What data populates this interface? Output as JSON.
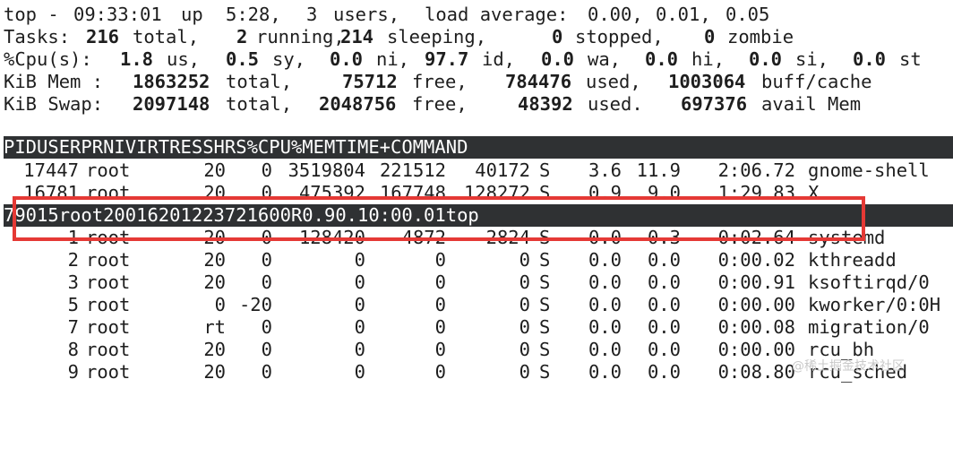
{
  "summary": {
    "uptime": {
      "title": "top - ",
      "time": "09:33:01",
      "up_label": "up",
      "up": "5:28,",
      "users": "3",
      "users_label": "users,",
      "load_label": "load average:",
      "load1": "0.00,",
      "load5": "0.01,",
      "load15": "0.05"
    },
    "tasks": {
      "label": "Tasks:",
      "total": "216",
      "total_label": "total,",
      "running": "2",
      "running_label": "running,",
      "sleeping": "214",
      "sleeping_label": "sleeping,",
      "stopped": "0",
      "stopped_label": "stopped,",
      "zombie": "0",
      "zombie_label": "zombie"
    },
    "cpu": {
      "label": "%Cpu(s):",
      "us": "1.8",
      "us_label": "us,",
      "sy": "0.5",
      "sy_label": "sy,",
      "ni": "0.0",
      "ni_label": "ni,",
      "id": "97.7",
      "id_label": "id,",
      "wa": "0.0",
      "wa_label": "wa,",
      "hi": "0.0",
      "hi_label": "hi,",
      "si": "0.0",
      "si_label": "si,",
      "st": "0.0",
      "st_label": "st"
    },
    "mem": {
      "label": "KiB Mem :",
      "total": "1863252",
      "total_label": "total,",
      "free": "75712",
      "free_label": "free,",
      "used": "784476",
      "used_label": "used,",
      "cache": "1003064",
      "cache_label": "buff/cache"
    },
    "swap": {
      "label": "KiB Swap:",
      "total": "2097148",
      "total_label": "total,",
      "free": "2048756",
      "free_label": "free,",
      "used": "48392",
      "used_label": "used.",
      "avail": "697376",
      "avail_label": "avail Mem"
    }
  },
  "columns": [
    "PID",
    "USER",
    "PR",
    "NI",
    "VIRT",
    "RES",
    "SHR",
    "S",
    "%CPU",
    "%MEM",
    "TIME+",
    "COMMAND"
  ],
  "processes": [
    [
      "17447",
      "root",
      "20",
      "0",
      "3519804",
      "221512",
      "40172",
      "S",
      "3.6",
      "11.9",
      "2:06.72",
      "gnome-shell"
    ],
    [
      "16781",
      "root",
      "20",
      "0",
      "475392",
      "167748",
      "128272",
      "S",
      "0.9",
      "9.0",
      "1:29.83",
      "X"
    ],
    [
      "79015",
      "root",
      "20",
      "0",
      "162012",
      "2372",
      "1600",
      "R",
      "0.9",
      "0.1",
      "0:00.01",
      "top"
    ],
    [
      "1",
      "root",
      "20",
      "0",
      "128420",
      "4872",
      "2824",
      "S",
      "0.0",
      "0.3",
      "0:02.64",
      "systemd"
    ],
    [
      "2",
      "root",
      "20",
      "0",
      "0",
      "0",
      "0",
      "S",
      "0.0",
      "0.0",
      "0:00.02",
      "kthreadd"
    ],
    [
      "3",
      "root",
      "20",
      "0",
      "0",
      "0",
      "0",
      "S",
      "0.0",
      "0.0",
      "0:00.91",
      "ksoftirqd/0"
    ],
    [
      "5",
      "root",
      "0",
      "-20",
      "0",
      "0",
      "0",
      "S",
      "0.0",
      "0.0",
      "0:00.00",
      "kworker/0:0H"
    ],
    [
      "7",
      "root",
      "rt",
      "0",
      "0",
      "0",
      "0",
      "S",
      "0.0",
      "0.0",
      "0:00.08",
      "migration/0"
    ],
    [
      "8",
      "root",
      "20",
      "0",
      "0",
      "0",
      "0",
      "S",
      "0.0",
      "0.0",
      "0:00.00",
      "rcu_bh"
    ],
    [
      "9",
      "root",
      "20",
      "0",
      "0",
      "0",
      "0",
      "S",
      "0.0",
      "0.0",
      "0:08.80",
      "rcu_sched"
    ]
  ],
  "selected_row": 2,
  "watermark": "@稀土掘金技术社区",
  "colors": {
    "header_bg": "#2f3133",
    "header_fg": "#ffffff",
    "text": "#1e1e1e",
    "highlight": "#e53935"
  }
}
